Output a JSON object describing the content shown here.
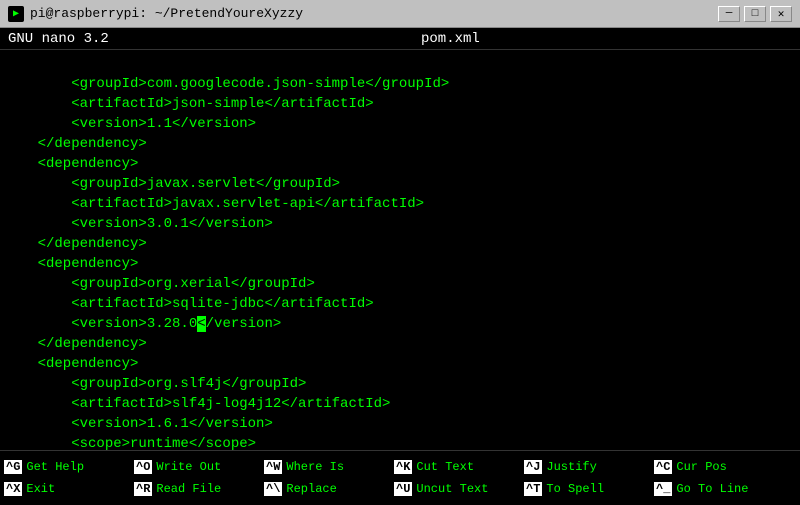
{
  "titlebar": {
    "icon_label": "▶",
    "title": "pi@raspberrypi: ~/PretendYoureXyzzy",
    "minimize": "─",
    "maximize": "□",
    "close": "✕"
  },
  "nano_header": {
    "left": "GNU nano 3.2",
    "center": "pom.xml"
  },
  "editor": {
    "lines": [
      "        <groupId>com.googlecode.json-simple</groupId>",
      "        <artifactId>json-simple</artifactId>",
      "        <version>1.1</version>",
      "    </dependency>",
      "    <dependency>",
      "        <groupId>javax.servlet</groupId>",
      "        <artifactId>javax.servlet-api</artifactId>",
      "        <version>3.0.1</version>",
      "    </dependency>",
      "    <dependency>",
      "        <groupId>org.xerial</groupId>",
      "        <artifactId>sqlite-jdbc</artifactId>",
      "        <version>3.28.0</version>",
      "    </dependency>",
      "    <dependency>",
      "        <groupId>org.slf4j</groupId>",
      "        <artifactId>slf4j-log4j12</artifactId>",
      "        <version>1.6.1</version>",
      "        <scope>runtime</scope>"
    ],
    "cursor_line": 12,
    "cursor_after": "<version>3.28.0</version>"
  },
  "footer": {
    "rows": [
      [
        {
          "key": "^G",
          "label": "Get Help"
        },
        {
          "key": "^O",
          "label": "Write Out"
        },
        {
          "key": "^W",
          "label": "Where Is"
        },
        {
          "key": "^K",
          "label": "Cut Text"
        },
        {
          "key": "^J",
          "label": "Justify"
        },
        {
          "key": "^C",
          "label": "Cur Pos"
        }
      ],
      [
        {
          "key": "^X",
          "label": "Exit"
        },
        {
          "key": "^R",
          "label": "Read File"
        },
        {
          "key": "^\\",
          "label": "Replace"
        },
        {
          "key": "^U",
          "label": "Uncut Text"
        },
        {
          "key": "^T",
          "label": "To Spell"
        },
        {
          "key": "^_",
          "label": "Go To Line"
        }
      ]
    ]
  }
}
